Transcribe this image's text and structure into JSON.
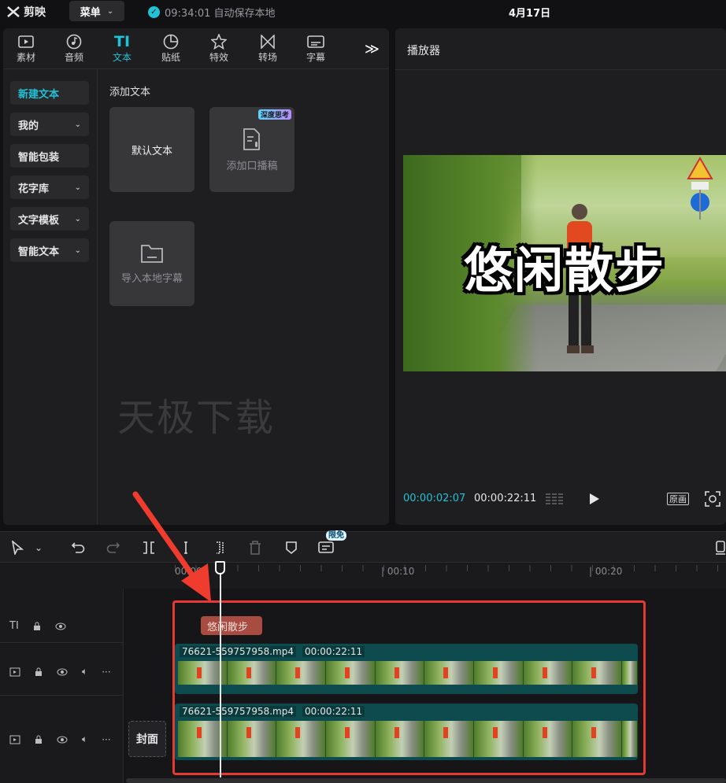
{
  "app": {
    "logo_text": "剪映",
    "menu_label": "菜单",
    "autosave_text": "09:34:01 自动保存本地",
    "date": "4月17日"
  },
  "tabs": [
    {
      "label": "素材",
      "icon": "media-icon"
    },
    {
      "label": "音频",
      "icon": "audio-icon"
    },
    {
      "label": "文本",
      "icon": "text-icon"
    },
    {
      "label": "贴纸",
      "icon": "sticker-icon"
    },
    {
      "label": "特效",
      "icon": "effects-icon"
    },
    {
      "label": "转场",
      "icon": "transition-icon"
    },
    {
      "label": "字幕",
      "icon": "subtitle-icon"
    }
  ],
  "leftnav": [
    "新建文本",
    "我的",
    "智能包装",
    "花字库",
    "文字模板",
    "智能文本"
  ],
  "content": {
    "section_title": "添加文本",
    "default_text": "默认文本",
    "add_script": "添加口播稿",
    "deep_badge": "深度思考",
    "import_subtitle": "导入本地字幕",
    "watermark": "天极下载"
  },
  "player": {
    "title": "播放器",
    "overlay_text": "悠闲散步",
    "current_time": "00:00:02:07",
    "total_time": "00:00:22:11",
    "original_label": "原画"
  },
  "toolbar": {
    "badge": "限免"
  },
  "ruler": {
    "marks": [
      "00:00",
      "00:10",
      "00:20"
    ]
  },
  "timeline": {
    "text_clip": "悠闲散步",
    "video_clip_name": "76621-559757958.mp4",
    "video_clip_duration": "00:00:22:11",
    "cover_label": "封面"
  },
  "colors": {
    "accent": "#21c1d6",
    "highlight_box": "#e53935",
    "text_clip": "#a84b40",
    "video_clip": "#0d4b4e"
  }
}
